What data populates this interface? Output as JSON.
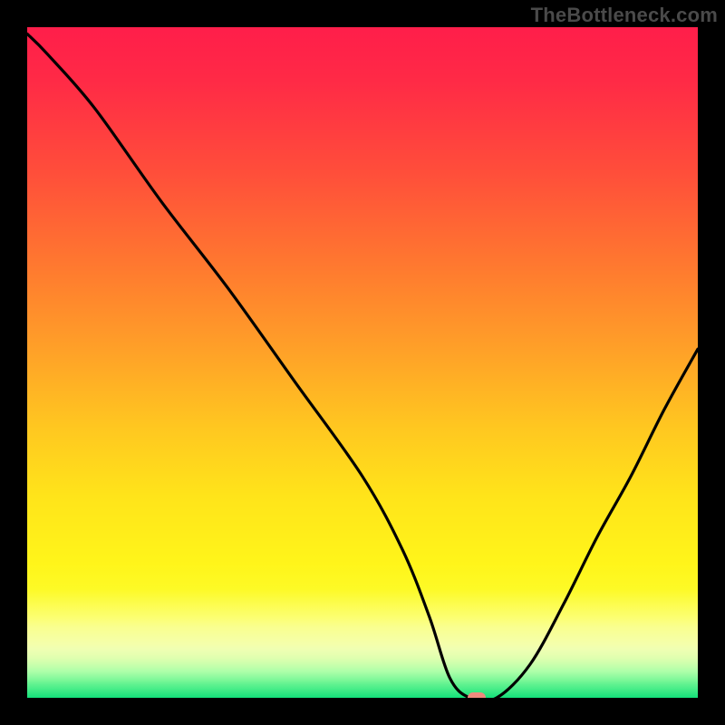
{
  "attribution": "TheBottleneck.com",
  "chart_data": {
    "type": "line",
    "title": "",
    "xlabel": "",
    "ylabel": "",
    "xlim": [
      0,
      100
    ],
    "ylim": [
      0,
      100
    ],
    "grid": false,
    "legend": false,
    "background": "red-yellow-green vertical gradient (bottleneck spectrum)",
    "series": [
      {
        "name": "bottleneck-curve",
        "color": "#000000",
        "x": [
          0,
          3,
          10,
          20,
          30,
          40,
          50,
          56,
          60,
          63,
          66,
          70,
          75,
          80,
          85,
          90,
          95,
          100
        ],
        "values": [
          99,
          96,
          88,
          74,
          61,
          47,
          33,
          22,
          12,
          3,
          0,
          0,
          5,
          14,
          24,
          33,
          43,
          52
        ]
      }
    ],
    "annotations": [
      {
        "name": "optimal-marker",
        "x": 67,
        "y": 0,
        "color": "#ef8a7e",
        "shape": "pill"
      }
    ]
  }
}
